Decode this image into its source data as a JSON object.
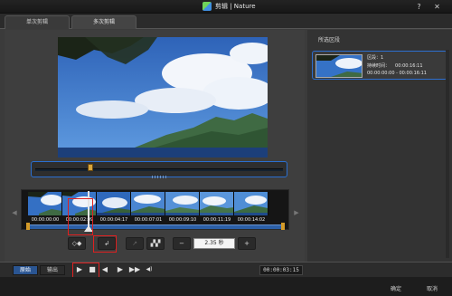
{
  "window": {
    "title": "剪辑 | Nature",
    "help": "?",
    "close": "✕"
  },
  "tabs": [
    {
      "label": "单次剪辑",
      "active": false
    },
    {
      "label": "多次剪辑",
      "active": true
    }
  ],
  "timeline": {
    "times": [
      "00:00:00:00",
      "00:00:02:09",
      "00:00:04:17",
      "00:00:07:01",
      "00:00:09:10",
      "00:00:11:19",
      "00:00:14:02"
    ],
    "nav_left": "◀",
    "nav_right": "▶"
  },
  "tools": {
    "mark": "◇◆",
    "split": "↲",
    "dim1": "↗",
    "film": "▞▞",
    "zoom_out": "−",
    "zoom_value": "2.35 秒",
    "zoom_in": "+"
  },
  "modes": [
    {
      "label": "原始",
      "active": true
    },
    {
      "label": "输出",
      "active": false
    }
  ],
  "playback": {
    "play": "▶",
    "stop": "■",
    "prev": "◀",
    "next": "▶",
    "fast": "▶▶",
    "volume": "◀)",
    "timecode": "00:00:03:15"
  },
  "panel": {
    "title": "所选区段",
    "item": {
      "segment_label": "区段：",
      "segment_value": "1",
      "duration_label": "持续时间：",
      "duration_value": "00:00:16:11",
      "range": "00:00:00:00 - 00:00:16:11"
    }
  },
  "footer": {
    "ok": "确定",
    "cancel": "取消"
  },
  "colors": {
    "accent": "#2d6fd0",
    "marker": "#e02020",
    "handle": "#d8a53a"
  }
}
